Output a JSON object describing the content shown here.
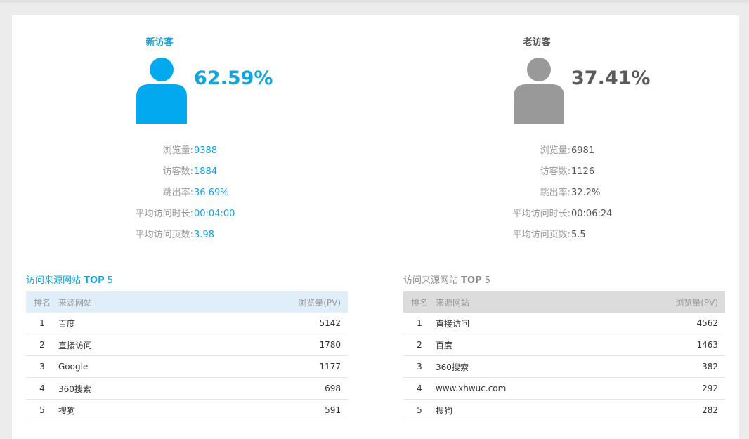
{
  "new_visitors": {
    "title": "新访客",
    "percent": "62.59%",
    "color": "#12a5dc",
    "stats": [
      {
        "label": "浏览量:",
        "value": "9388"
      },
      {
        "label": "访客数:",
        "value": "1884"
      },
      {
        "label": "跳出率:",
        "value": "36.69%"
      },
      {
        "label": "平均访问时长:",
        "value": "00:04:00"
      },
      {
        "label": "平均访问页数:",
        "value": "3.98"
      }
    ],
    "table": {
      "title_prefix": "访问来源网站",
      "title_bold": "TOP",
      "title_suffix": "5",
      "headers": {
        "rank": "排名",
        "site": "来源网站",
        "pv": "浏览量(PV)"
      },
      "rows": [
        {
          "rank": "1",
          "site": "百度",
          "pv": "5142"
        },
        {
          "rank": "2",
          "site": "直接访问",
          "pv": "1780"
        },
        {
          "rank": "3",
          "site": "Google",
          "pv": "1177"
        },
        {
          "rank": "4",
          "site": "360搜索",
          "pv": "698"
        },
        {
          "rank": "5",
          "site": "搜狗",
          "pv": "591"
        }
      ]
    }
  },
  "returning_visitors": {
    "title": "老访客",
    "percent": "37.41%",
    "color": "#999999",
    "stats": [
      {
        "label": "浏览量:",
        "value": "6981"
      },
      {
        "label": "访客数:",
        "value": "1126"
      },
      {
        "label": "跳出率:",
        "value": "32.2%"
      },
      {
        "label": "平均访问时长:",
        "value": "00:06:24"
      },
      {
        "label": "平均访问页数:",
        "value": "5.5"
      }
    ],
    "table": {
      "title_prefix": "访问来源网站",
      "title_bold": "TOP",
      "title_suffix": "5",
      "headers": {
        "rank": "排名",
        "site": "来源网站",
        "pv": "浏览量(PV)"
      },
      "rows": [
        {
          "rank": "1",
          "site": "直接访问",
          "pv": "4562"
        },
        {
          "rank": "2",
          "site": "百度",
          "pv": "1463"
        },
        {
          "rank": "3",
          "site": "360搜索",
          "pv": "382"
        },
        {
          "rank": "4",
          "site": "www.xhwuc.com",
          "pv": "292"
        },
        {
          "rank": "5",
          "site": "搜狗",
          "pv": "282"
        }
      ]
    }
  },
  "icons": {
    "person": "person-icon"
  }
}
